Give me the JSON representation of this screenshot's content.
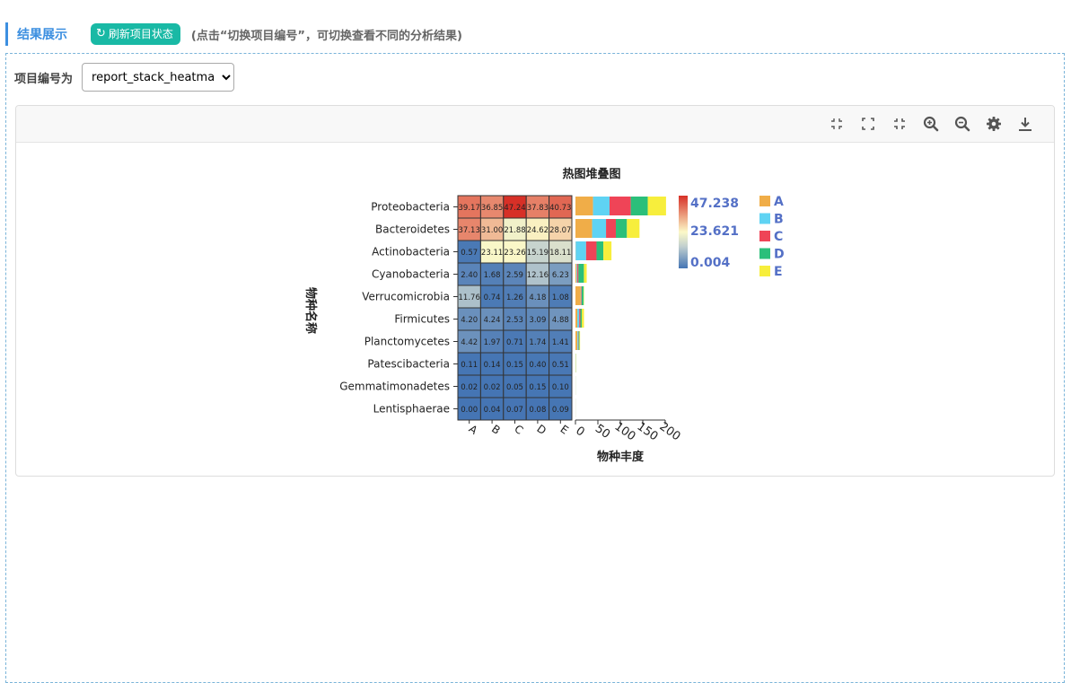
{
  "header": {
    "title": "结果展示",
    "refresh_label": "刷新项目状态",
    "hint": "(点击“切换项目编号”，可切换查看不同的分析结果)"
  },
  "project": {
    "label": "项目编号为",
    "selected": "report_stack_heatmap"
  },
  "toolbar": {
    "icons": [
      "collapse-icon",
      "fullscreen-icon",
      "exit-fullscreen-icon",
      "zoom-in-icon",
      "zoom-out-icon",
      "gear-icon",
      "download-icon"
    ]
  },
  "chart_data": {
    "type": "heatmap",
    "title": "热图堆叠图",
    "ylabel": "物种名称",
    "xlabel": "物种丰度",
    "categories": [
      "A",
      "B",
      "C",
      "D",
      "E"
    ],
    "rows": [
      "Proteobacteria",
      "Bacteroidetes",
      "Actinobacteria",
      "Cyanobacteria",
      "Verrucomicrobia",
      "Firmicutes",
      "Planctomycetes",
      "Patescibacteria",
      "Gemmatimonadetes",
      "Lentisphaerae"
    ],
    "values": [
      [
        39.17,
        36.85,
        47.24,
        37.83,
        40.73
      ],
      [
        37.13,
        31.0,
        21.88,
        24.62,
        28.07
      ],
      [
        0.57,
        23.11,
        23.26,
        15.19,
        18.11
      ],
      [
        2.4,
        1.68,
        2.59,
        12.16,
        6.23
      ],
      [
        11.76,
        0.74,
        1.26,
        4.18,
        1.08
      ],
      [
        4.2,
        4.24,
        2.53,
        3.09,
        4.88
      ],
      [
        4.42,
        1.97,
        0.71,
        1.74,
        1.41
      ],
      [
        0.11,
        0.14,
        0.15,
        0.4,
        0.51
      ],
      [
        0.02,
        0.02,
        0.05,
        0.15,
        0.1
      ],
      [
        0.0,
        0.04,
        0.07,
        0.08,
        0.09
      ]
    ],
    "colorbar": {
      "max": "47.238",
      "mid": "23.621",
      "min": "0.004"
    },
    "bar_axis_ticks": [
      "0",
      "50",
      "100",
      "150",
      "200"
    ],
    "bar_axis_range": [
      0,
      200
    ],
    "series_colors": [
      "#f0ad48",
      "#5fd3f3",
      "#ef4457",
      "#2bbf7a",
      "#f7ee3c"
    ],
    "heat_colors": {
      "low": "#4575b4",
      "mid": "#fcf9c8",
      "high": "#d73027",
      "lowmid": "#c1cfcf"
    },
    "legend_placement": "right",
    "legend_color": "#5470c6"
  }
}
